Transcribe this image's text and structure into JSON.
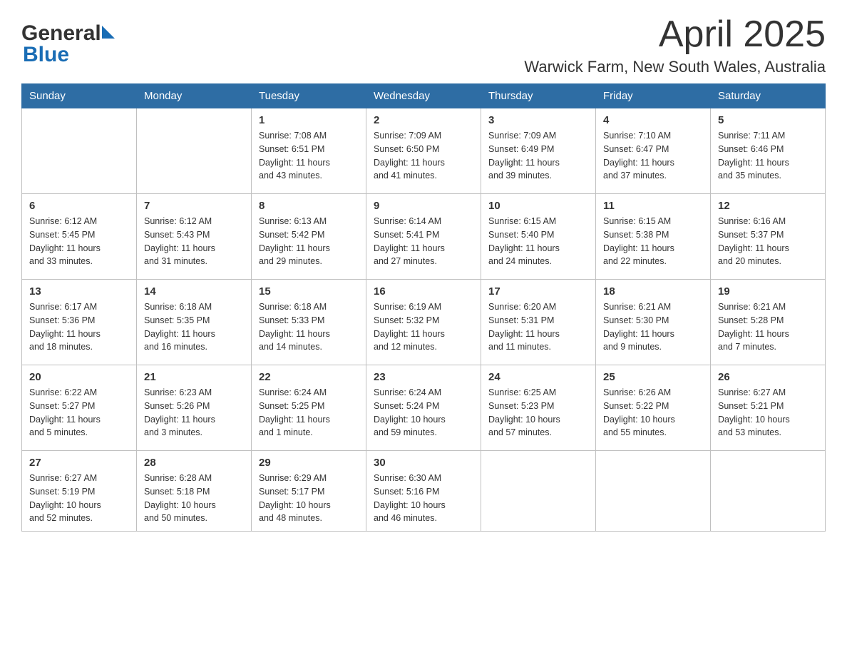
{
  "header": {
    "title": "April 2025",
    "subtitle": "Warwick Farm, New South Wales, Australia",
    "logo_general": "General",
    "logo_blue": "Blue"
  },
  "weekdays": [
    "Sunday",
    "Monday",
    "Tuesday",
    "Wednesday",
    "Thursday",
    "Friday",
    "Saturday"
  ],
  "weeks": [
    [
      {
        "day": "",
        "info": ""
      },
      {
        "day": "",
        "info": ""
      },
      {
        "day": "1",
        "info": "Sunrise: 7:08 AM\nSunset: 6:51 PM\nDaylight: 11 hours\nand 43 minutes."
      },
      {
        "day": "2",
        "info": "Sunrise: 7:09 AM\nSunset: 6:50 PM\nDaylight: 11 hours\nand 41 minutes."
      },
      {
        "day": "3",
        "info": "Sunrise: 7:09 AM\nSunset: 6:49 PM\nDaylight: 11 hours\nand 39 minutes."
      },
      {
        "day": "4",
        "info": "Sunrise: 7:10 AM\nSunset: 6:47 PM\nDaylight: 11 hours\nand 37 minutes."
      },
      {
        "day": "5",
        "info": "Sunrise: 7:11 AM\nSunset: 6:46 PM\nDaylight: 11 hours\nand 35 minutes."
      }
    ],
    [
      {
        "day": "6",
        "info": "Sunrise: 6:12 AM\nSunset: 5:45 PM\nDaylight: 11 hours\nand 33 minutes."
      },
      {
        "day": "7",
        "info": "Sunrise: 6:12 AM\nSunset: 5:43 PM\nDaylight: 11 hours\nand 31 minutes."
      },
      {
        "day": "8",
        "info": "Sunrise: 6:13 AM\nSunset: 5:42 PM\nDaylight: 11 hours\nand 29 minutes."
      },
      {
        "day": "9",
        "info": "Sunrise: 6:14 AM\nSunset: 5:41 PM\nDaylight: 11 hours\nand 27 minutes."
      },
      {
        "day": "10",
        "info": "Sunrise: 6:15 AM\nSunset: 5:40 PM\nDaylight: 11 hours\nand 24 minutes."
      },
      {
        "day": "11",
        "info": "Sunrise: 6:15 AM\nSunset: 5:38 PM\nDaylight: 11 hours\nand 22 minutes."
      },
      {
        "day": "12",
        "info": "Sunrise: 6:16 AM\nSunset: 5:37 PM\nDaylight: 11 hours\nand 20 minutes."
      }
    ],
    [
      {
        "day": "13",
        "info": "Sunrise: 6:17 AM\nSunset: 5:36 PM\nDaylight: 11 hours\nand 18 minutes."
      },
      {
        "day": "14",
        "info": "Sunrise: 6:18 AM\nSunset: 5:35 PM\nDaylight: 11 hours\nand 16 minutes."
      },
      {
        "day": "15",
        "info": "Sunrise: 6:18 AM\nSunset: 5:33 PM\nDaylight: 11 hours\nand 14 minutes."
      },
      {
        "day": "16",
        "info": "Sunrise: 6:19 AM\nSunset: 5:32 PM\nDaylight: 11 hours\nand 12 minutes."
      },
      {
        "day": "17",
        "info": "Sunrise: 6:20 AM\nSunset: 5:31 PM\nDaylight: 11 hours\nand 11 minutes."
      },
      {
        "day": "18",
        "info": "Sunrise: 6:21 AM\nSunset: 5:30 PM\nDaylight: 11 hours\nand 9 minutes."
      },
      {
        "day": "19",
        "info": "Sunrise: 6:21 AM\nSunset: 5:28 PM\nDaylight: 11 hours\nand 7 minutes."
      }
    ],
    [
      {
        "day": "20",
        "info": "Sunrise: 6:22 AM\nSunset: 5:27 PM\nDaylight: 11 hours\nand 5 minutes."
      },
      {
        "day": "21",
        "info": "Sunrise: 6:23 AM\nSunset: 5:26 PM\nDaylight: 11 hours\nand 3 minutes."
      },
      {
        "day": "22",
        "info": "Sunrise: 6:24 AM\nSunset: 5:25 PM\nDaylight: 11 hours\nand 1 minute."
      },
      {
        "day": "23",
        "info": "Sunrise: 6:24 AM\nSunset: 5:24 PM\nDaylight: 10 hours\nand 59 minutes."
      },
      {
        "day": "24",
        "info": "Sunrise: 6:25 AM\nSunset: 5:23 PM\nDaylight: 10 hours\nand 57 minutes."
      },
      {
        "day": "25",
        "info": "Sunrise: 6:26 AM\nSunset: 5:22 PM\nDaylight: 10 hours\nand 55 minutes."
      },
      {
        "day": "26",
        "info": "Sunrise: 6:27 AM\nSunset: 5:21 PM\nDaylight: 10 hours\nand 53 minutes."
      }
    ],
    [
      {
        "day": "27",
        "info": "Sunrise: 6:27 AM\nSunset: 5:19 PM\nDaylight: 10 hours\nand 52 minutes."
      },
      {
        "day": "28",
        "info": "Sunrise: 6:28 AM\nSunset: 5:18 PM\nDaylight: 10 hours\nand 50 minutes."
      },
      {
        "day": "29",
        "info": "Sunrise: 6:29 AM\nSunset: 5:17 PM\nDaylight: 10 hours\nand 48 minutes."
      },
      {
        "day": "30",
        "info": "Sunrise: 6:30 AM\nSunset: 5:16 PM\nDaylight: 10 hours\nand 46 minutes."
      },
      {
        "day": "",
        "info": ""
      },
      {
        "day": "",
        "info": ""
      },
      {
        "day": "",
        "info": ""
      }
    ]
  ]
}
